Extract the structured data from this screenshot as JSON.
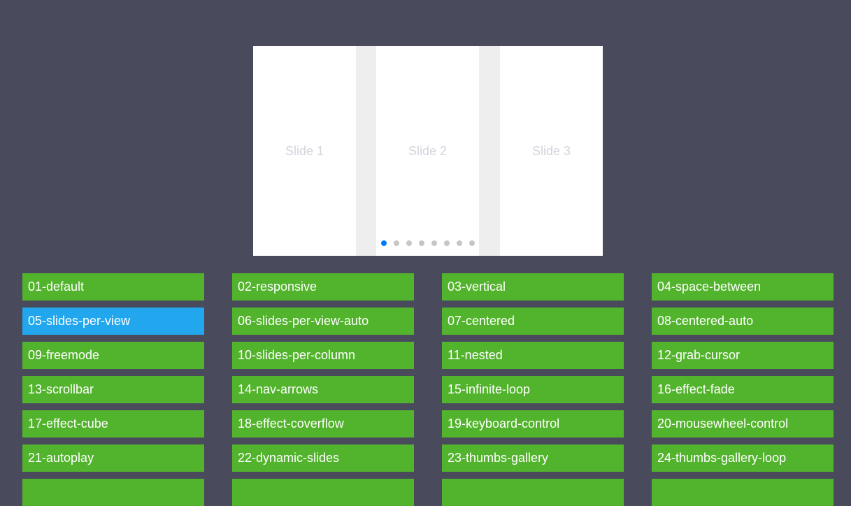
{
  "carousel": {
    "slides": [
      "Slide 1",
      "Slide 2",
      "Slide 3"
    ],
    "pagination_count": 8,
    "active_page": 1
  },
  "colors": {
    "background": "#4a4a5d",
    "link": "#52b32c",
    "link_selected": "#22a7ee",
    "dot_active": "#007aff"
  },
  "demos": [
    "01-default",
    "02-responsive",
    "03-vertical",
    "04-space-between",
    "05-slides-per-view",
    "06-slides-per-view-auto",
    "07-centered",
    "08-centered-auto",
    "09-freemode",
    "10-slides-per-column",
    "11-nested",
    "12-grab-cursor",
    "13-scrollbar",
    "14-nav-arrows",
    "15-infinite-loop",
    "16-effect-fade",
    "17-effect-cube",
    "18-effect-coverflow",
    "19-keyboard-control",
    "20-mousewheel-control",
    "21-autoplay",
    "22-dynamic-slides",
    "23-thumbs-gallery",
    "24-thumbs-gallery-loop",
    "",
    "",
    "",
    ""
  ],
  "selected_demo": "05-slides-per-view"
}
